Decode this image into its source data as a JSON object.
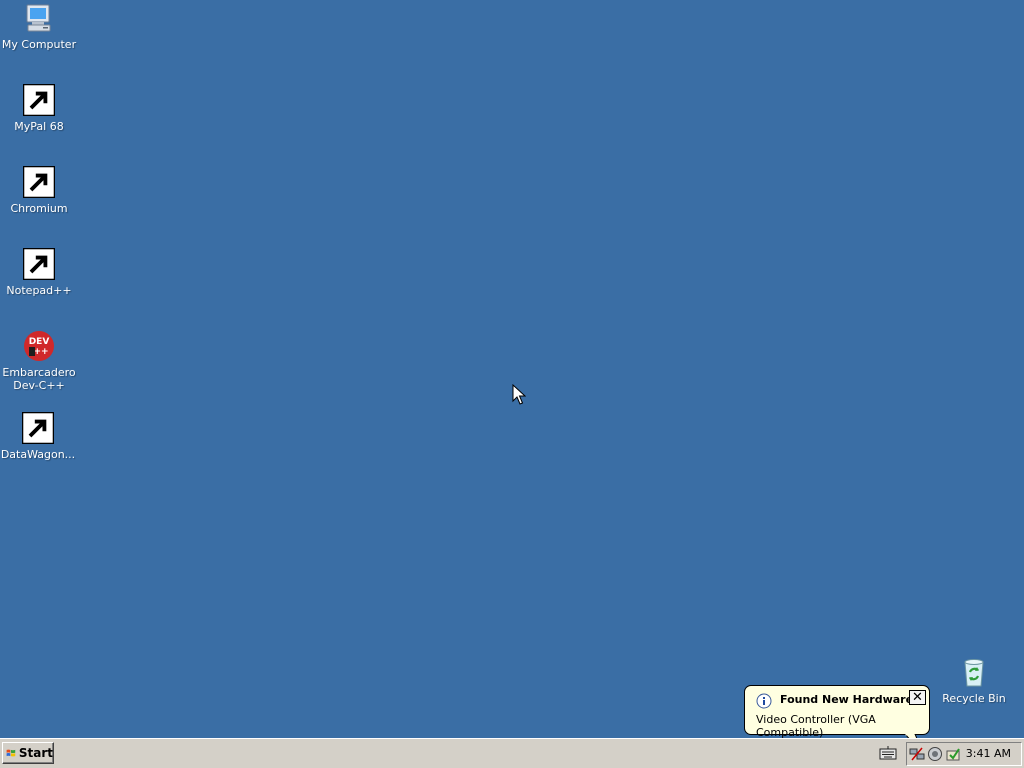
{
  "desktop": {
    "background": "#3a6ea5",
    "icons": [
      {
        "label": "My Computer",
        "icon": "computer-icon",
        "shortcut": false
      },
      {
        "label": "MyPal 68",
        "icon": "raccoon-icon",
        "shortcut": true
      },
      {
        "label": "Chromium",
        "icon": "chromium-icon",
        "shortcut": true
      },
      {
        "label": "Notepad++",
        "icon": "notepad-plus-plus-icon",
        "shortcut": true
      },
      {
        "label": "Embarcadero Dev-C++",
        "icon": "devcpp-icon",
        "shortcut": false
      },
      {
        "label": "DataWagon...",
        "icon": "datawagon-icon",
        "shortcut": true
      },
      {
        "label": "Recycle Bin",
        "icon": "recycle-bin-icon",
        "shortcut": false
      }
    ]
  },
  "balloon": {
    "title": "Found New Hardware",
    "body": "Video Controller (VGA Compatible)",
    "close_label": "✕",
    "background": "#ffffe1"
  },
  "taskbar": {
    "start_label": "Start",
    "clock": "3:41 AM",
    "tray_icons": [
      "network-icon",
      "speaker-icon",
      "update-icon"
    ]
  }
}
